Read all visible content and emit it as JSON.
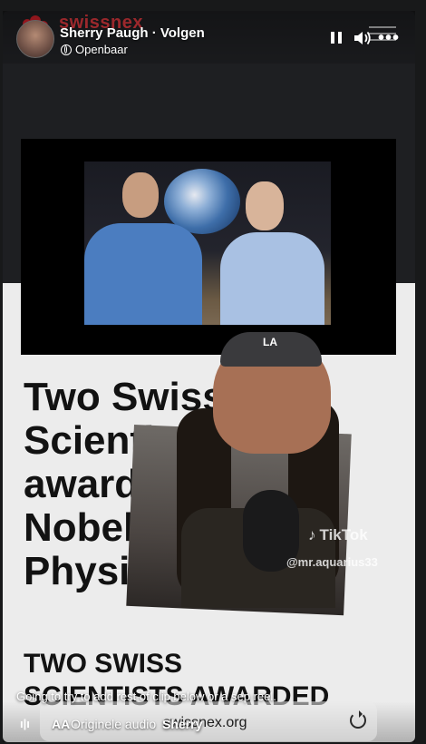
{
  "post": {
    "author": "Sherry Paugh",
    "separator": " · ",
    "follow_label": "Volgen",
    "privacy": "Openbaar"
  },
  "controls": {
    "pause_icon": "pause-icon",
    "volume_icon": "volume-icon",
    "more_icon": "more-icon",
    "more_label": "•••"
  },
  "webpage": {
    "logo_text": "swissnex",
    "headline_lines": [
      "Two Swiss",
      "Scientists",
      "awarded",
      "Nobel",
      "Physics"
    ],
    "subhead_lines": [
      "TWO SWISS",
      "SCIENTISTS AWARDED"
    ],
    "aa_label": "AA",
    "url": "swissnex.org",
    "reload_icon": "reload-icon"
  },
  "overlay": {
    "tiktok_brand": "TikTok",
    "tiktok_handle": "@mr.aquarius33"
  },
  "caption": "Going to try to add rest  of clip below or a sep reel.",
  "audio": {
    "icon": "audio-wave-icon",
    "label": "Originele audio"
  },
  "tag_user": "Sherry"
}
